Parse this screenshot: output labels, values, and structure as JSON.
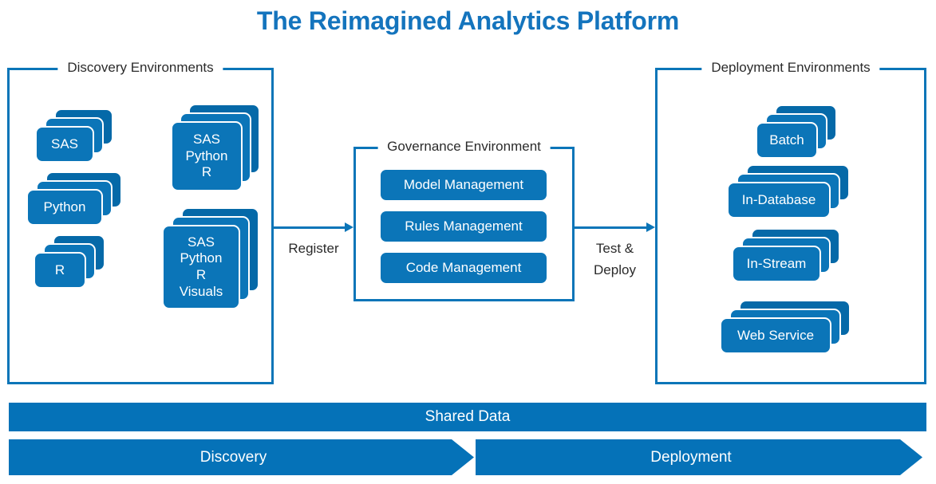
{
  "title": "The Reimagined Analytics Platform",
  "colors": {
    "brand_blue": "#0B75B8",
    "bar_blue": "#0572B8",
    "title_blue": "#1474BD",
    "card_back_blue": "#0569A8",
    "text_dark": "#2b2b2b",
    "card_text": "#ffffff",
    "background": "#ffffff"
  },
  "discovery": {
    "label": "Discovery Environments",
    "cards": [
      {
        "text": "SAS"
      },
      {
        "text": "Python"
      },
      {
        "text": "R"
      },
      {
        "text": "SAS\nPython\nR"
      },
      {
        "text": "SAS\nPython\nR\nVisuals"
      }
    ]
  },
  "governance": {
    "label": "Governance Environment",
    "items": [
      {
        "label": "Model Management"
      },
      {
        "label": "Rules Management"
      },
      {
        "label": "Code Management"
      }
    ]
  },
  "deployment": {
    "label": "Deployment Environments",
    "cards": [
      {
        "text": "Batch"
      },
      {
        "text": "In-Database"
      },
      {
        "text": "In-Stream"
      },
      {
        "text": "Web Service"
      }
    ]
  },
  "arrows": [
    {
      "label": "Register"
    },
    {
      "label": "Test &\nDeploy"
    }
  ],
  "footer": {
    "shared_data": "Shared Data",
    "phases": [
      {
        "label": "Discovery"
      },
      {
        "label": "Deployment"
      }
    ]
  }
}
